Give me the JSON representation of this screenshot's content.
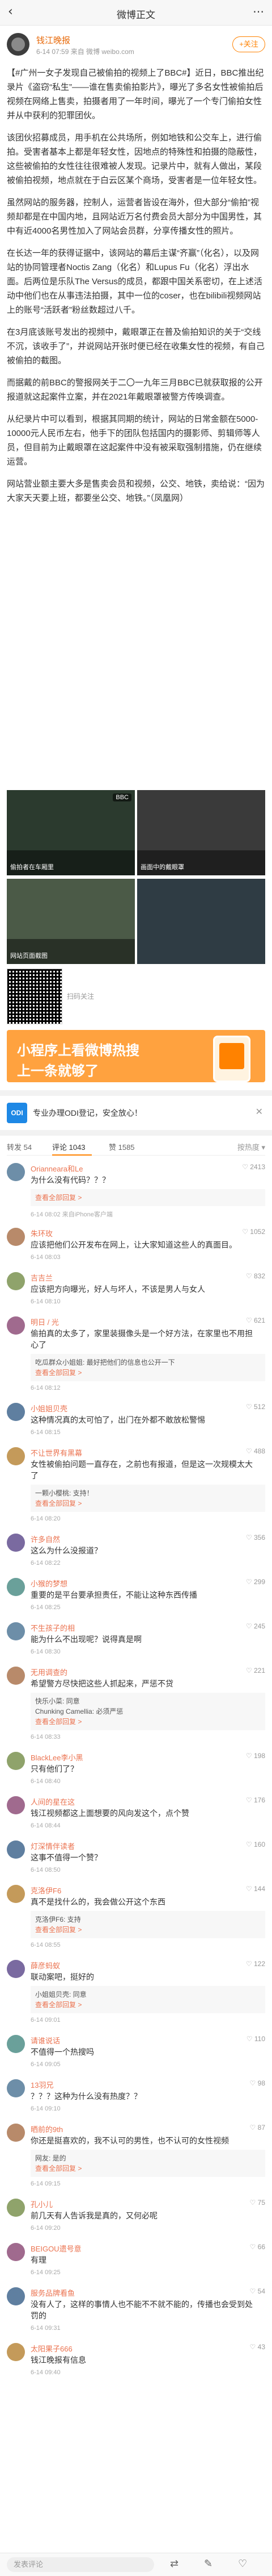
{
  "nav": {
    "back_icon": "chevron-left-icon",
    "title": "微博正文",
    "more_icon": "more-icon"
  },
  "author": {
    "name": "钱江晚报",
    "meta": "6-14 07:59 来自 微博 weibo.com",
    "follow_label": "+关注"
  },
  "article": {
    "p1": "【#广州一女子发现自己被偷拍的视频上了BBC#】近日，BBC推出纪录片《盗窃“私生”——谁在售卖偷拍影片》，曝光了多名女性被偷拍后视频在网络上售卖，拍摄者用了一年时间，曝光了一个专门偷拍女性并从中获利的犯罪团伙。",
    "p2": "该团伙招募成员，用手机在公共场所，例如地铁和公交车上，进行偷拍。受害者基本上都是年轻女性，因地点的特殊性和拍摄的隐蔽性，这些被偷拍的女性往往很难被人发现。记录片中，就有人做出，某段被偷拍视频，地点就在于白云区某个商场，受害者是一位年轻女性。",
    "p3": "虽然网站的服务器，控制人，运营者皆设在海外，但大部分“偷拍”视频却都是在中国内地，且网站近万名付费会员大部分为中国男性，其中有近4000名男性加入了网站会员群，分享传播女性的照片。",
    "p4": "在长达一年的获得证据中，该网站的幕后主谋“齐赢”（化名），以及网站的协同管理者Noctis Zang（化名）和Lupus Fu（化名）浮出水面。后两位是乐队The Versus的成员，都跟中国关系密切，在上述活动中他们也在从事违法拍摄，其中一位的coser，也在bilibili视频网站上的账号“活跃者”粉丝数超过八千。",
    "p5": "在3月底该账号发出的视频中，戴眼罩正在普及偷拍知识的关于“交线不沉，该收手了”，并说网站开张时便已经在收集女性的视频，有自己被偷拍的截图。",
    "p6": "而据戴的前BBC的警报网关于二〇一九年三月BBC已就获取报的公开报道就这起案件立案，并在2021年戴眼罩被警方传唤调查。",
    "p7": "从纪录片中可以看到，根据其同期的统计，网站的日常金额在5000-10000元人民币左右，他手下的团队包括国内的摄影师、剪辑师等人员，但目前为止戴眼罩在这起案件中没有被采取强制措施，仍在继续运营。",
    "p8": "网站营业额主要大多是售卖会员和视频，公交、地铁，卖给说：“因为大家天天要上班，都要坐公交、地铁。”（凤凰网）"
  },
  "photos": [
    {
      "caption": "偷拍者在车厢里",
      "tag": "BBC"
    },
    {
      "caption": "画面中的戴眼罩",
      "tag": ""
    },
    {
      "caption": "",
      "tag": ""
    },
    {
      "caption": "",
      "tag": ""
    }
  ],
  "second_photo_caption": "网站页面截图",
  "qr_caption": "扫码关注",
  "banner": {
    "line1": "小程序上看微博热搜",
    "line2": "上一条就够了"
  },
  "ad": {
    "logo_text": "ODI",
    "text": "专业办理ODI登记，安全放心！"
  },
  "tabs": {
    "repost": "转发 54",
    "comment": "评论 1043",
    "like": "赞 1585",
    "sort": "按热度 ▾"
  },
  "comments": [
    {
      "name": "Orianneara和Le",
      "text": "为什么没有代码？？？",
      "time": "6-14 08:02 来自iPhone客户端",
      "likes": "2413",
      "replies": [
        "查看全部回复 >"
      ]
    },
    {
      "name": "朱环玫",
      "text": "应该把他们公开发布在网上，让大家知道这些人的真面目。",
      "time": "6-14 08:03",
      "likes": "1052",
      "replies": []
    },
    {
      "name": "吉吉兰",
      "text": "应该把方向曝光，好人与坏人，不该是男人与女人",
      "time": "6-14 08:10",
      "likes": "832",
      "replies": []
    },
    {
      "name": "明日 / 光",
      "text": "偷拍真的太多了，家里装摄像头是一个好方法，在家里也不用担心了",
      "time": "6-14 08:12",
      "likes": "621",
      "replies": [
        "吃瓜群众小姐姐: 最好把他们的信息也公开一下",
        "查看全部回复 >"
      ]
    },
    {
      "name": "小姐姐贝壳",
      "text": "这种情况真的太可怕了，出门在外都不敢放松警惕",
      "time": "6-14 08:15",
      "likes": "512",
      "replies": []
    },
    {
      "name": "不让世界有黑幕",
      "text": "女性被偷拍问题一直存在，之前也有报道，但是这一次规模太大了",
      "time": "6-14 08:20",
      "likes": "488",
      "replies": [
        "一颗小樱桃: 支持！",
        "查看全部回复 >"
      ]
    },
    {
      "name": "许多自然",
      "text": "这么为什么没报道？",
      "time": "6-14 08:22",
      "likes": "356",
      "replies": []
    },
    {
      "name": "小猴的梦想",
      "text": "重要的是平台要承担责任，不能让这种东西传播",
      "time": "6-14 08:25",
      "likes": "299",
      "replies": []
    },
    {
      "name": "不生孩子的相",
      "text": "能为什么不出现呢？说得真是啊",
      "time": "6-14 08:30",
      "likes": "245",
      "replies": []
    },
    {
      "name": "无用调查的",
      "text": "希望警方尽快把这些人抓起来，严惩不贷",
      "time": "6-14 08:33",
      "likes": "221",
      "replies": [
        "快乐小菜: 同意",
        "Chunking Camellia: 必须严惩",
        "查看全部回复 >"
      ]
    },
    {
      "name": "BlackLee李小黑",
      "text": "只有他们了？",
      "time": "6-14 08:40",
      "likes": "198",
      "replies": []
    },
    {
      "name": "人间的星在这",
      "text": "钱江视频都这上面想要的风向发这个，点个赞",
      "time": "6-14 08:44",
      "likes": "176",
      "replies": []
    },
    {
      "name": "灯深情伴读者",
      "text": "这事不值得一个赞？",
      "time": "6-14 08:50",
      "likes": "160",
      "replies": []
    },
    {
      "name": "克洛伊F6",
      "text": "真不是找什么的，我会做公开这个东西",
      "time": "6-14 08:55",
      "likes": "144",
      "replies": [
        "克洛伊F6: 支持",
        "查看全部回复 >"
      ]
    },
    {
      "name": "薛彦蚂蚁",
      "text": "联动案吧，挺好的",
      "time": "6-14 09:01",
      "likes": "122",
      "replies": [
        "小姐姐贝壳: 同意",
        "查看全部回复 >"
      ]
    },
    {
      "name": "请谁说话",
      "text": "不值得一个热搜吗",
      "time": "6-14 09:05",
      "likes": "110",
      "replies": []
    },
    {
      "name": "13羽兄",
      "text": "？？？这种为什么没有热度？？",
      "time": "6-14 09:10",
      "likes": "98",
      "replies": []
    },
    {
      "name": "晒前的9th",
      "text": "你还是挺喜欢的，我不认可的男性，也不认可的女性视频",
      "time": "6-14 09:15",
      "likes": "87",
      "replies": [
        "网友: 是的",
        "查看全部回复 >"
      ]
    },
    {
      "name": "孔小儿",
      "text": "前几天有人告诉我是真的，又何必呢",
      "time": "6-14 09:20",
      "likes": "75",
      "replies": []
    },
    {
      "name": "BEIGOU遗号意",
      "text": "有理",
      "time": "6-14 09:25",
      "likes": "66",
      "replies": []
    },
    {
      "name": "服务品牌看鱼",
      "text": "没有人了，这样的事情人也不能不不就不能的，传播也会受到处罚的",
      "time": "6-14 09:31",
      "likes": "54",
      "replies": []
    },
    {
      "name": "太阳果子666",
      "text": "钱江晚报有信息",
      "time": "6-14 09:40",
      "likes": "43",
      "replies": []
    }
  ],
  "bottombar": {
    "input_placeholder": "发表评论",
    "repost_icon": "repost-icon",
    "comment_icon": "comment-icon",
    "like_icon": "like-icon"
  }
}
